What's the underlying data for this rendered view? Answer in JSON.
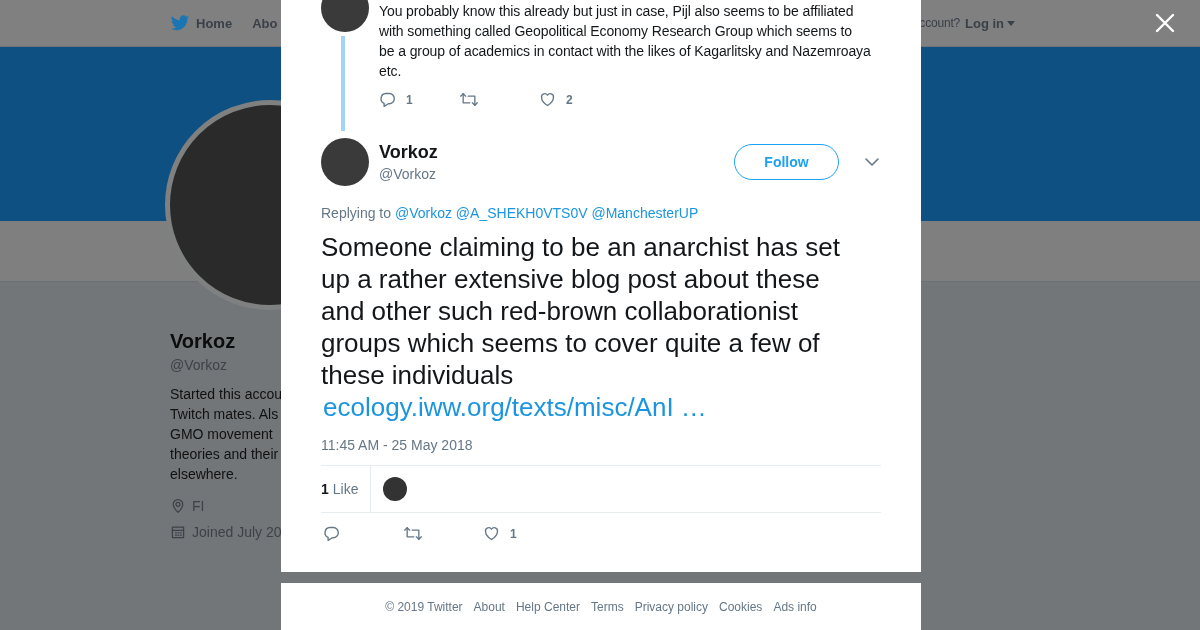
{
  "background_page": {
    "nav_items": [
      {
        "label": "Home",
        "selected": false
      },
      {
        "label": "Abo",
        "selected": false
      }
    ],
    "login_prompt": "ccount?",
    "login_label": "Log in",
    "profile": {
      "name": "Vorkoz",
      "handle": "@Vorkoz",
      "bio_lines": [
        "Started this accou",
        "Twitch mates. Als",
        "GMO movement",
        "theories and their",
        "elsewhere."
      ],
      "location": "FI",
      "joined": "Joined July 20"
    }
  },
  "modal": {
    "previous_tweet": {
      "text": "You probably know this already but just in case, Pijl also seems to be affiliated with something called Geopolitical Economy Research Group which seems to be a group of academics in contact with the likes of Kagarlitsky and Nazemroaya etc.",
      "reply_count": "1",
      "like_count": "2"
    },
    "tweet": {
      "name": "Vorkoz",
      "handle": "@Vorkoz",
      "follow_label": "Follow",
      "replying_label": "Replying to",
      "mentions": [
        "@Vorkoz",
        "@A_SHEKH0VTS0V",
        "@ManchesterUP"
      ],
      "text": "Someone claiming to be an anarchist has set up a rather extensive blog post about these and other such red-brown collaborationist groups which seems to cover quite a few of these individuals",
      "link": "ecology.iww.org/texts/misc/AnI …",
      "timestamp": "11:45 AM - 25 May 2018",
      "like_stat_count": "1",
      "like_stat_label": "Like",
      "like_count": "1"
    },
    "footer_links": [
      "© 2019 Twitter",
      "About",
      "Help Center",
      "Terms",
      "Privacy policy",
      "Cookies",
      "Ads info"
    ]
  }
}
